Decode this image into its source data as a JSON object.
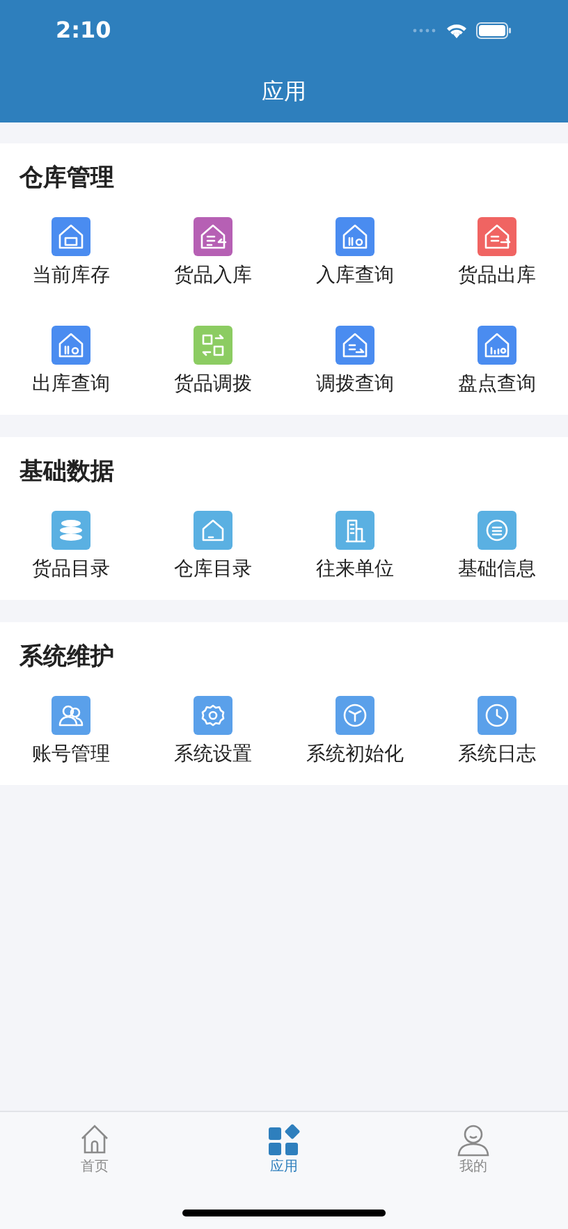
{
  "status_bar": {
    "time": "2:10"
  },
  "header": {
    "title": "应用"
  },
  "sections": [
    {
      "title": "仓库管理",
      "items": [
        {
          "label": "当前库存",
          "color": "#4a8cf0"
        },
        {
          "label": "货品入库",
          "color": "#b660b4"
        },
        {
          "label": "入库查询",
          "color": "#4a8cf0"
        },
        {
          "label": "货品出库",
          "color": "#f06462"
        },
        {
          "label": "出库查询",
          "color": "#4a8cf0"
        },
        {
          "label": "货品调拨",
          "color": "#8ccc62"
        },
        {
          "label": "调拨查询",
          "color": "#4a8cf0"
        },
        {
          "label": "盘点查询",
          "color": "#4a8cf0"
        }
      ]
    },
    {
      "title": "基础数据",
      "items": [
        {
          "label": "货品目录",
          "color": "#5ab0e2"
        },
        {
          "label": "仓库目录",
          "color": "#5ab0e2"
        },
        {
          "label": "往来单位",
          "color": "#5ab0e2"
        },
        {
          "label": "基础信息",
          "color": "#5ab0e2"
        }
      ]
    },
    {
      "title": "系统维护",
      "items": [
        {
          "label": "账号管理",
          "color": "#5aa0ea"
        },
        {
          "label": "系统设置",
          "color": "#5aa0ea"
        },
        {
          "label": "系统初始化",
          "color": "#5aa0ea"
        },
        {
          "label": "系统日志",
          "color": "#5aa0ea"
        }
      ]
    }
  ],
  "tab_bar": [
    {
      "label": "首页",
      "selected": false
    },
    {
      "label": "应用",
      "selected": true
    },
    {
      "label": "我的",
      "selected": false
    }
  ]
}
